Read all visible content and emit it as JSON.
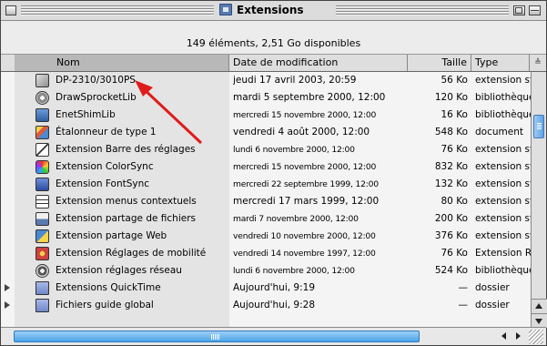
{
  "window": {
    "title": "Extensions"
  },
  "status": {
    "text": "149 éléments, 2,51 Go disponibles"
  },
  "columns": {
    "name": "Nom",
    "date": "Date de modification",
    "size": "Taille",
    "type": "Type"
  },
  "rows": [
    {
      "icon": "puzzle-icon",
      "name": "DP-2310/3010PS",
      "date": "jeudi 17 avril 2003, 20:59",
      "size": "56 Ko",
      "type": "extension sys"
    },
    {
      "icon": "gear-icon",
      "name": "DrawSprocketLib",
      "date": "mardi 5 septembre 2000, 12:00",
      "size": "120 Ko",
      "type": "bibliothèque"
    },
    {
      "icon": "network-icon",
      "name": "EnetShimLib",
      "date": "mercredi 15 novembre 2000, 12:00",
      "size": "16 Ko",
      "type": "bibliothèque"
    },
    {
      "icon": "paint-icon",
      "name": "Étalonneur de type 1",
      "date": "vendredi 4 août 2000, 12:00",
      "size": "548 Ko",
      "type": "document"
    },
    {
      "icon": "cube-icon",
      "name": "Extension Barre des réglages",
      "date": "lundi 6 novembre 2000, 12:00",
      "size": "76 Ko",
      "type": "extension sys"
    },
    {
      "icon": "colorsync-icon",
      "name": "Extension ColorSync",
      "date": "mercredi 15 novembre 2000, 12:00",
      "size": "832 Ko",
      "type": "extension sys"
    },
    {
      "icon": "font-icon",
      "name": "Extension FontSync",
      "date": "mercredi 22 septembre 1999, 12:00",
      "size": "132 Ko",
      "type": "extension sys"
    },
    {
      "icon": "menu-icon",
      "name": "Extension menus contextuels",
      "date": "mercredi 17 mars 1999, 12:00",
      "size": "80 Ko",
      "type": "extension sys"
    },
    {
      "icon": "file-sharing-icon",
      "name": "Extension partage de fichiers",
      "date": "mardi 7 novembre 2000, 12:00",
      "size": "200 Ko",
      "type": "extension sys"
    },
    {
      "icon": "web-sharing-icon",
      "name": "Extension partage Web",
      "date": "vendredi 10 novembre 2000, 12:00",
      "size": "376 Ko",
      "type": "extension sys"
    },
    {
      "icon": "mobility-icon",
      "name": "Extension Réglages de mobilité",
      "date": "vendredi 14 novembre 1997, 12:00",
      "size": "76 Ko",
      "type": "Extension Rés"
    },
    {
      "icon": "network-settings-icon",
      "name": "Extension réglages réseau",
      "date": "lundi 6 novembre 2000, 12:00",
      "size": "524 Ko",
      "type": "bibliothèque"
    },
    {
      "icon": "folder-icon",
      "name": "Extensions QuickTime",
      "date": "Aujourd'hui, 9:19",
      "size": "—",
      "type": "dossier",
      "disclosure": true
    },
    {
      "icon": "folder-icon",
      "name": "Fichiers guide global",
      "date": "Aujourd'hui, 9:28",
      "size": "—",
      "type": "dossier",
      "disclosure": true
    }
  ],
  "colors": {
    "accent": "#5fa3e6",
    "annotation_arrow": "#e01b1b",
    "header_sorted": "#b8b8b8"
  }
}
